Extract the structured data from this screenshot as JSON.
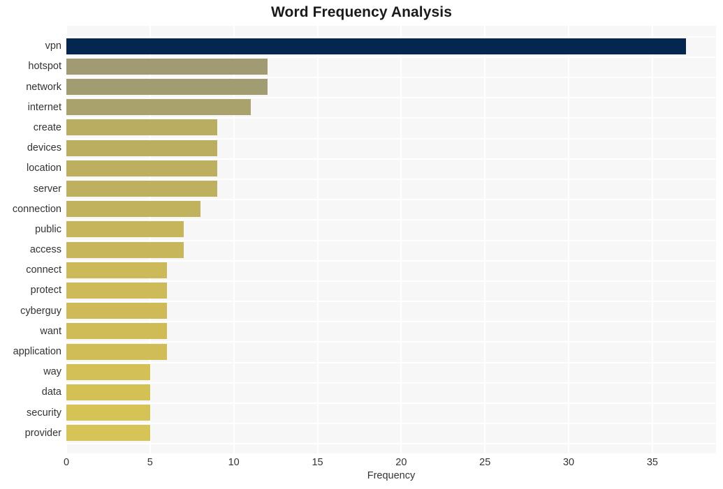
{
  "chart_data": {
    "type": "bar",
    "orientation": "horizontal",
    "title": "Word Frequency Analysis",
    "xlabel": "Frequency",
    "ylabel": "",
    "xlim": [
      0,
      38.8
    ],
    "xticks": [
      0,
      5,
      10,
      15,
      20,
      25,
      30,
      35
    ],
    "xtick_labels": [
      "0",
      "5",
      "10",
      "15",
      "20",
      "25",
      "30",
      "35"
    ],
    "grid": true,
    "legend": null,
    "categories": [
      "vpn",
      "hotspot",
      "network",
      "internet",
      "create",
      "devices",
      "location",
      "server",
      "connection",
      "public",
      "access",
      "connect",
      "protect",
      "cyberguy",
      "want",
      "application",
      "way",
      "data",
      "security",
      "provider"
    ],
    "values": [
      37,
      12,
      12,
      11,
      9,
      9,
      9,
      9,
      8,
      7,
      7,
      6,
      6,
      6,
      6,
      6,
      5,
      5,
      5,
      5
    ],
    "bar_colors": [
      "#04274f",
      "#a09b73",
      "#a29c72",
      "#a9a26c",
      "#b9ad62",
      "#bbae61",
      "#bcaf60",
      "#bdb05f",
      "#c1b35d",
      "#c6b55b",
      "#c8b65b",
      "#ccb959",
      "#cdba58",
      "#cebb58",
      "#cfbc57",
      "#d0bd57",
      "#d3c056",
      "#d4c156",
      "#d6c356",
      "#d7c456"
    ],
    "plot_background": "#f7f7f7",
    "gridline_color": "#ffffff",
    "figure_background": "#ffffff"
  }
}
